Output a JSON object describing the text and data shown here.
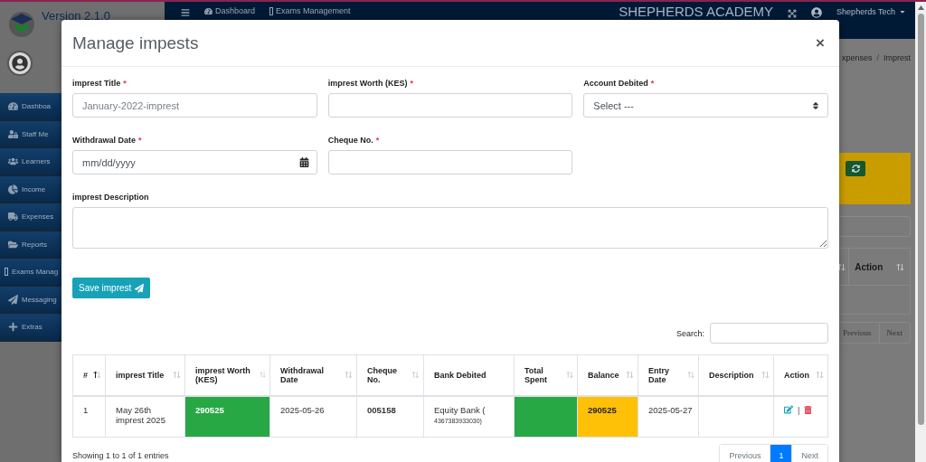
{
  "sidebar": {
    "version": "Version 2.1.0",
    "items": [
      {
        "label": "Dashboa"
      },
      {
        "label": "Staff Me"
      },
      {
        "label": "Learners"
      },
      {
        "label": "Income"
      },
      {
        "label": "Expenses"
      },
      {
        "label": "Reports"
      },
      {
        "label": "Exams Manag"
      },
      {
        "label": "Messaging"
      },
      {
        "label": "Extras"
      }
    ]
  },
  "navbar": {
    "links": [
      {
        "label": "Dashboard"
      },
      {
        "label": "Exams Management"
      }
    ],
    "brand": "SHEPHERDS ACADEMY",
    "user": "Shepherds Tech"
  },
  "background": {
    "breadcrumb": [
      "xpenses",
      "Imprest"
    ],
    "breadcrumb_separator": "/",
    "table_header": "Action",
    "pagination": [
      "Previous",
      "Next"
    ]
  },
  "modal": {
    "title": "Manage impests",
    "close": "×",
    "fields": [
      {
        "kind": "text",
        "label": "imprest Title",
        "mark": "*",
        "placeholder": "January-2022-imprest"
      },
      {
        "kind": "text",
        "label": "imprest Worth (KES)",
        "mark": "*"
      },
      {
        "kind": "select",
        "label": "Account Debited",
        "mark": "*",
        "value": "Select ---"
      },
      {
        "kind": "date",
        "label": "Withdrawal Date",
        "mark": "*",
        "placeholder": "mm/dd/yyyy"
      },
      {
        "kind": "text",
        "label": "Cheque No.",
        "mark": "*"
      },
      {
        "kind": "textarea",
        "label": "imprest Description"
      }
    ],
    "save_button": "Save imprest",
    "search_label": "Search:",
    "table": {
      "columns": [
        {
          "label": "#",
          "sortable": true,
          "sorted": true
        },
        {
          "label": "imprest Title",
          "sortable": true,
          "sorted": false
        },
        {
          "label": "imprest Worth (KES)",
          "sortable": true,
          "sorted": false
        },
        {
          "label": "Withdrawal Date",
          "sortable": true,
          "sorted": false
        },
        {
          "label": "Cheque No.",
          "sortable": true,
          "sorted": false
        },
        {
          "label": "Bank Debited",
          "sortable": false
        },
        {
          "label": "Total Spent",
          "sortable": true,
          "sorted": false
        },
        {
          "label": "Balance",
          "sortable": true,
          "sorted": false
        },
        {
          "label": "Entry Date",
          "sortable": true,
          "sorted": false
        },
        {
          "label": "Description",
          "sortable": true,
          "sorted": false
        },
        {
          "label": "Action",
          "sortable": true,
          "sorted": false
        }
      ],
      "rows": [
        {
          "cells": [
            {
              "text": "1"
            },
            {
              "text": "May 26th imprest 2025"
            },
            {
              "text": "290525",
              "bold": true,
              "color": "#28a745"
            },
            {
              "text": "2025-05-26"
            },
            {
              "text": "005158",
              "bold": true
            },
            {
              "text": "Equity Bank (",
              "subtext": "4367383933030)"
            },
            {
              "color": "#28a745"
            },
            {
              "text": "290525",
              "bold": true,
              "color": "#ffc107"
            },
            {
              "text": "2025-05-27"
            },
            {},
            {
              "kind": "actions",
              "separator": "|"
            }
          ]
        }
      ]
    },
    "info": "Showing 1 to 1 of 1 entries",
    "pagination": [
      {
        "label": "Previous",
        "selected": false
      },
      {
        "label": "1",
        "selected": true
      },
      {
        "label": "Next",
        "selected": false
      }
    ]
  }
}
